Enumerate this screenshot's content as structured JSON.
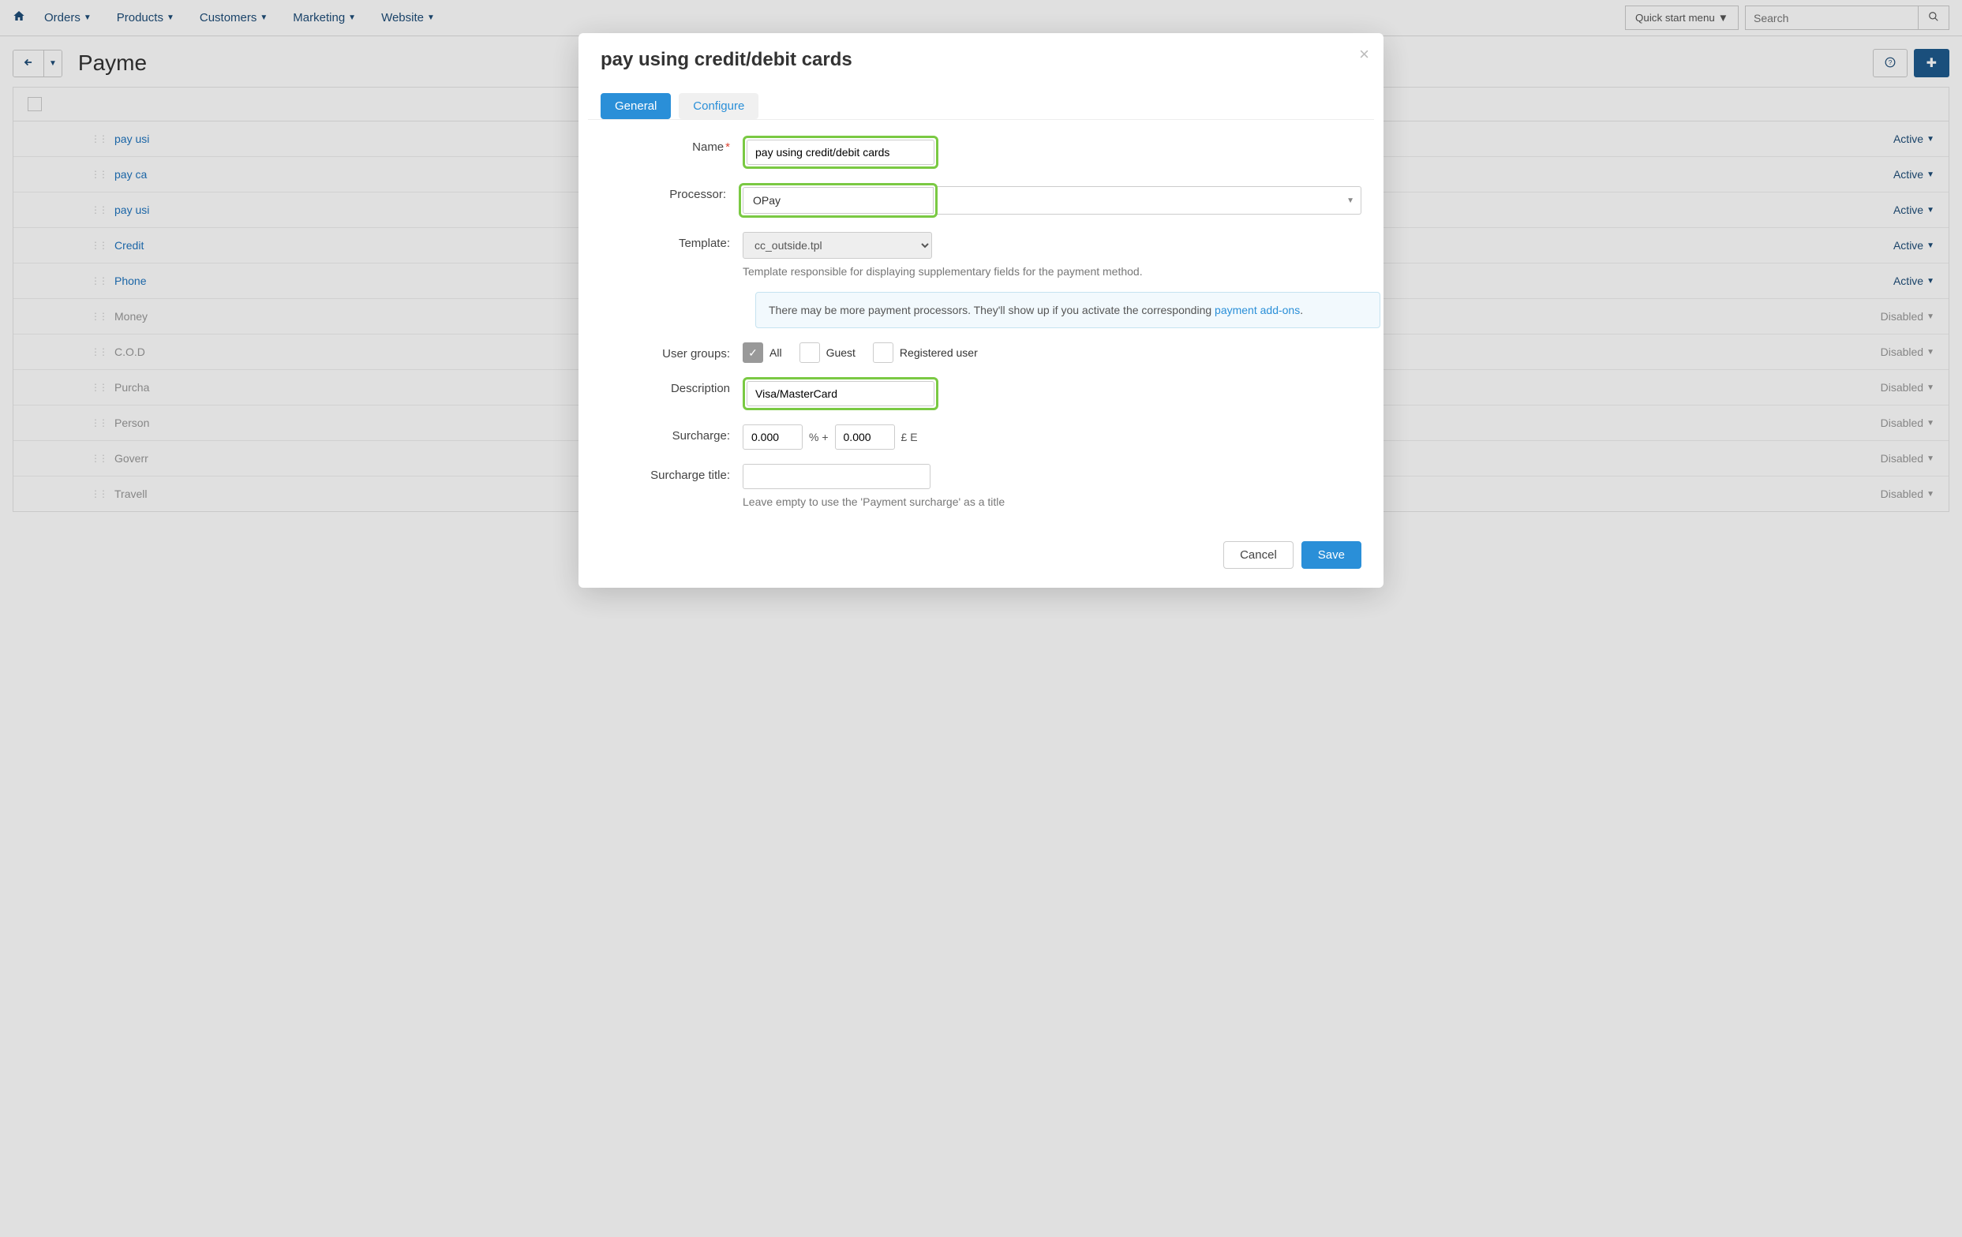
{
  "nav": {
    "menu": [
      "Orders",
      "Products",
      "Customers",
      "Marketing",
      "Website"
    ],
    "quick_start": "Quick start menu",
    "search_placeholder": "Search"
  },
  "page": {
    "title": "Payme"
  },
  "rows": [
    {
      "name": "pay usi",
      "status": "Active",
      "disabled": false
    },
    {
      "name": "pay ca",
      "status": "Active",
      "disabled": false
    },
    {
      "name": "pay usi",
      "status": "Active",
      "disabled": false
    },
    {
      "name": "Credit",
      "status": "Active",
      "disabled": false
    },
    {
      "name": "Phone",
      "status": "Active",
      "disabled": false
    },
    {
      "name": "Money",
      "status": "Disabled",
      "disabled": true
    },
    {
      "name": "C.O.D",
      "status": "Disabled",
      "disabled": true
    },
    {
      "name": "Purcha",
      "status": "Disabled",
      "disabled": true
    },
    {
      "name": "Person",
      "status": "Disabled",
      "disabled": true
    },
    {
      "name": "Goverr",
      "status": "Disabled",
      "disabled": true
    },
    {
      "name": "Travell",
      "status": "Disabled",
      "disabled": true
    }
  ],
  "modal": {
    "title": "pay using credit/debit cards",
    "tabs": {
      "general": "General",
      "configure": "Configure"
    },
    "labels": {
      "name": "Name",
      "processor": "Processor:",
      "template": "Template:",
      "user_groups": "User groups:",
      "description": "Description",
      "surcharge": "Surcharge:",
      "surcharge_title": "Surcharge title:"
    },
    "values": {
      "name": "pay using credit/debit cards",
      "processor": "OPay",
      "template": "cc_outside.tpl",
      "description": "Visa/MasterCard",
      "surcharge_pct": "0.000",
      "surcharge_flat": "0.000",
      "surcharge_title": ""
    },
    "helper": {
      "template": "Template responsible for displaying supplementary fields for the payment method.",
      "surcharge_title": "Leave empty to use the 'Payment surcharge' as a title"
    },
    "info": {
      "pre": "There may be more payment processors. They'll show up if you activate the corresponding ",
      "link": "payment add-ons",
      "post": "."
    },
    "user_groups": {
      "all": "All",
      "guest": "Guest",
      "registered": "Registered user"
    },
    "surcharge_units": {
      "pct": "% +",
      "flat": "£ E"
    },
    "buttons": {
      "cancel": "Cancel",
      "save": "Save"
    }
  }
}
